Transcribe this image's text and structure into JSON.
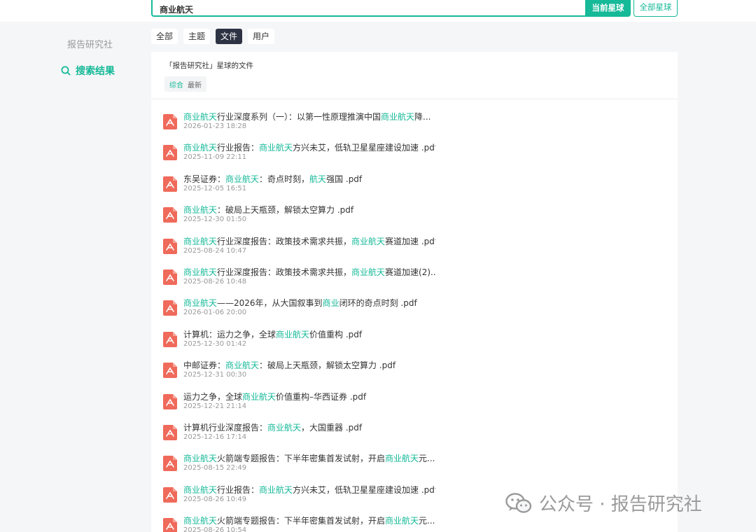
{
  "search": {
    "value": "商业航天",
    "current_button": "当前星球",
    "all_button": "全部星球"
  },
  "sidebar": {
    "title": "报告研究社",
    "result_label": "搜索结果"
  },
  "tabs": [
    "全部",
    "主题",
    "文件",
    "用户"
  ],
  "active_tab": "文件",
  "panel": {
    "header": "「报告研究社」星球的文件",
    "sub_tabs": [
      "综合",
      "最新"
    ]
  },
  "highlight_color": "#16b998",
  "files": [
    {
      "title_parts": [
        [
          "商业航天",
          true
        ],
        [
          "行业深度系列（一）：以第一性原理推演中国",
          false
        ],
        [
          "商业航天",
          true
        ],
        [
          "降...",
          false
        ]
      ],
      "date": "2026-01-23 18:28"
    },
    {
      "title_parts": [
        [
          "商业航天",
          true
        ],
        [
          "行业报告：",
          false
        ],
        [
          "商业航天",
          true
        ],
        [
          "方兴未艾，低轨卫星星座建设加速 .pdf",
          false
        ]
      ],
      "date": "2025-11-09 22:11"
    },
    {
      "title_parts": [
        [
          "东吴证券：",
          false
        ],
        [
          "商业航天",
          true
        ],
        [
          "：奇点时刻，",
          false
        ],
        [
          "航天",
          true
        ],
        [
          "强国 .pdf",
          false
        ]
      ],
      "date": "2025-12-05 16:51"
    },
    {
      "title_parts": [
        [
          "商业航天",
          true
        ],
        [
          "：破局上天瓶颈，解锁太空算力 .pdf",
          false
        ]
      ],
      "date": "2025-12-30 01:50"
    },
    {
      "title_parts": [
        [
          "商业航天",
          true
        ],
        [
          "行业深度报告：政策技术需求共振，",
          false
        ],
        [
          "商业航天",
          true
        ],
        [
          "赛道加速 .pdf",
          false
        ]
      ],
      "date": "2025-08-24 10:47"
    },
    {
      "title_parts": [
        [
          "商业航天",
          true
        ],
        [
          "行业深度报告：政策技术需求共振，",
          false
        ],
        [
          "商业航天",
          true
        ],
        [
          "赛道加速(2)...",
          false
        ]
      ],
      "date": "2025-08-26 10:48"
    },
    {
      "title_parts": [
        [
          "商业航天",
          true
        ],
        [
          "——2026年，从大国叙事到",
          false
        ],
        [
          "商业",
          true
        ],
        [
          "闭环的奇点时刻 .pdf",
          false
        ]
      ],
      "date": "2026-01-06 20:00"
    },
    {
      "title_parts": [
        [
          "计算机：运力之争，全球",
          false
        ],
        [
          "商业航天",
          true
        ],
        [
          "价值重构 .pdf",
          false
        ]
      ],
      "date": "2025-12-30 01:42"
    },
    {
      "title_parts": [
        [
          "中邮证券：",
          false
        ],
        [
          "商业航天",
          true
        ],
        [
          "：破局上天瓶颈，解锁太空算力 .pdf",
          false
        ]
      ],
      "date": "2025-12-31 00:30"
    },
    {
      "title_parts": [
        [
          "运力之争，全球",
          false
        ],
        [
          "商业航天",
          true
        ],
        [
          "价值重构–华西证券 .pdf",
          false
        ]
      ],
      "date": "2025-12-21 21:14"
    },
    {
      "title_parts": [
        [
          "计算机行业深度报告：",
          false
        ],
        [
          "商业航天",
          true
        ],
        [
          "，大国重器 .pdf",
          false
        ]
      ],
      "date": "2025-12-16 17:14"
    },
    {
      "title_parts": [
        [
          "商业航天",
          true
        ],
        [
          "火箭端专题报告：下半年密集首发试射，开启",
          false
        ],
        [
          "商业航天",
          true
        ],
        [
          "元...",
          false
        ]
      ],
      "date": "2025-08-15 22:49"
    },
    {
      "title_parts": [
        [
          "商业航天",
          true
        ],
        [
          "行业报告：",
          false
        ],
        [
          "商业航天",
          true
        ],
        [
          "方兴未艾，低轨卫星星座建设加速 .pdf",
          false
        ]
      ],
      "date": "2025-08-26 10:49"
    },
    {
      "title_parts": [
        [
          "商业航天",
          true
        ],
        [
          "火箭端专题报告：下半年密集首发试射，开启",
          false
        ],
        [
          "商业航天",
          true
        ],
        [
          "元...",
          false
        ]
      ],
      "date": "2025-08-26 10:54"
    }
  ],
  "watermark": {
    "text": "公众号 · 报告研究社",
    "icon": "wechat-icon"
  }
}
